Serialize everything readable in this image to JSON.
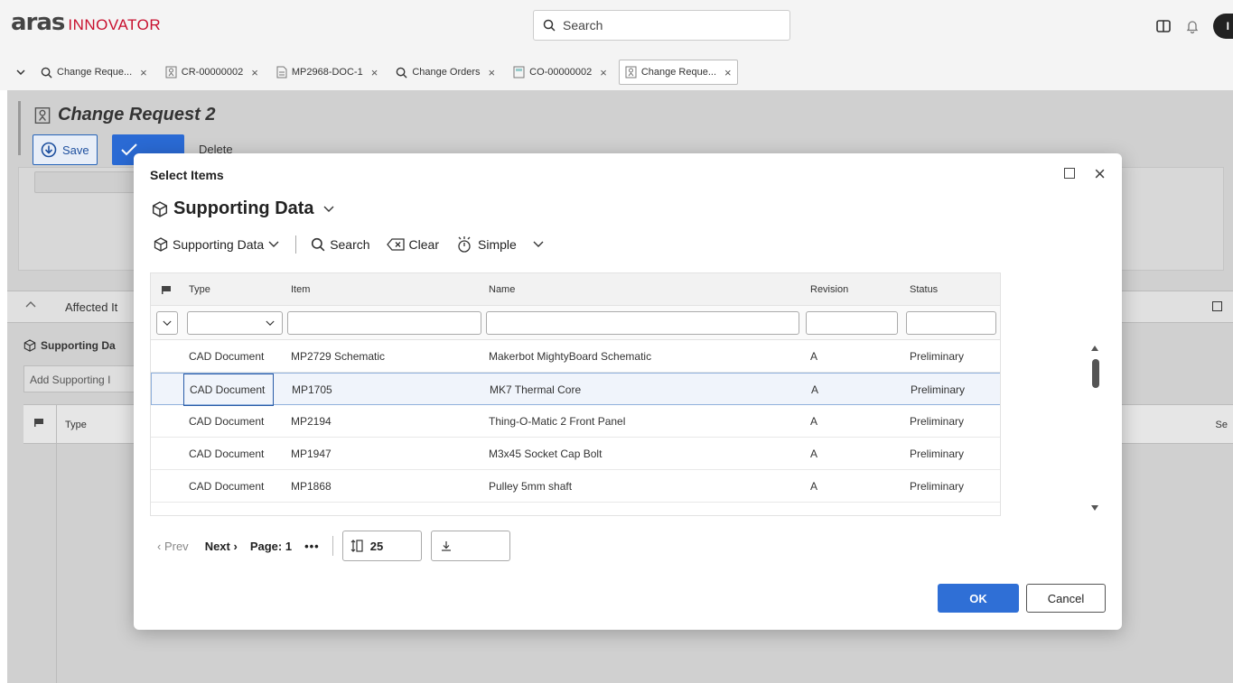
{
  "app": {
    "logo_main": "aras",
    "logo_sub": "INNOVATOR",
    "search_placeholder": "Search",
    "avatar_initial": "I"
  },
  "tabs": [
    {
      "label": "Change Reque...",
      "icon": "search-icon"
    },
    {
      "label": "CR-00000002",
      "icon": "change-request-icon"
    },
    {
      "label": "MP2968-DOC-1",
      "icon": "document-icon"
    },
    {
      "label": "Change Orders",
      "icon": "search-icon"
    },
    {
      "label": "CO-00000002",
      "icon": "change-order-icon"
    },
    {
      "label": "Change Reque...",
      "icon": "change-request-icon",
      "active": true
    }
  ],
  "form": {
    "title": "Change Request 2",
    "save_label": "Save",
    "done_label": "Done",
    "delete_label": "Delete",
    "affected_label": "Affected It",
    "supporting_label": "Supporting Da",
    "add_supporting_placeholder": "Add Supporting I",
    "col_type": "Type",
    "col_se": "Se"
  },
  "dialog": {
    "title": "Select Items",
    "heading": "Supporting Data",
    "toolbar": {
      "itemtype_label": "Supporting Data",
      "search_label": "Search",
      "clear_label": "Clear",
      "mode_label": "Simple"
    },
    "columns": [
      "Type",
      "Item",
      "Name",
      "Revision",
      "Status"
    ],
    "rows": [
      {
        "type": "CAD Document",
        "item": "MP2729 Schematic",
        "name": "Makerbot MightyBoard Schematic",
        "revision": "A",
        "status": "Preliminary"
      },
      {
        "type": "CAD Document",
        "item": "MP1705",
        "name": "MK7 Thermal Core",
        "revision": "A",
        "status": "Preliminary",
        "selected": true
      },
      {
        "type": "CAD Document",
        "item": "MP2194",
        "name": "Thing-O-Matic 2 Front Panel",
        "revision": "A",
        "status": "Preliminary"
      },
      {
        "type": "CAD Document",
        "item": "MP1947",
        "name": "M3x45 Socket Cap Bolt",
        "revision": "A",
        "status": "Preliminary"
      },
      {
        "type": "CAD Document",
        "item": "MP1868",
        "name": "Pulley 5mm shaft",
        "revision": "A",
        "status": "Preliminary"
      }
    ],
    "pager": {
      "prev_label": "Prev",
      "next_label": "Next",
      "page_label": "Page: 1",
      "dots": "•••",
      "page_size": "25"
    },
    "ok_label": "OK",
    "cancel_label": "Cancel"
  },
  "colors": {
    "brand_red": "#c8102e",
    "primary_blue": "#2f6fd6",
    "selected_border": "#8fb0dc"
  }
}
